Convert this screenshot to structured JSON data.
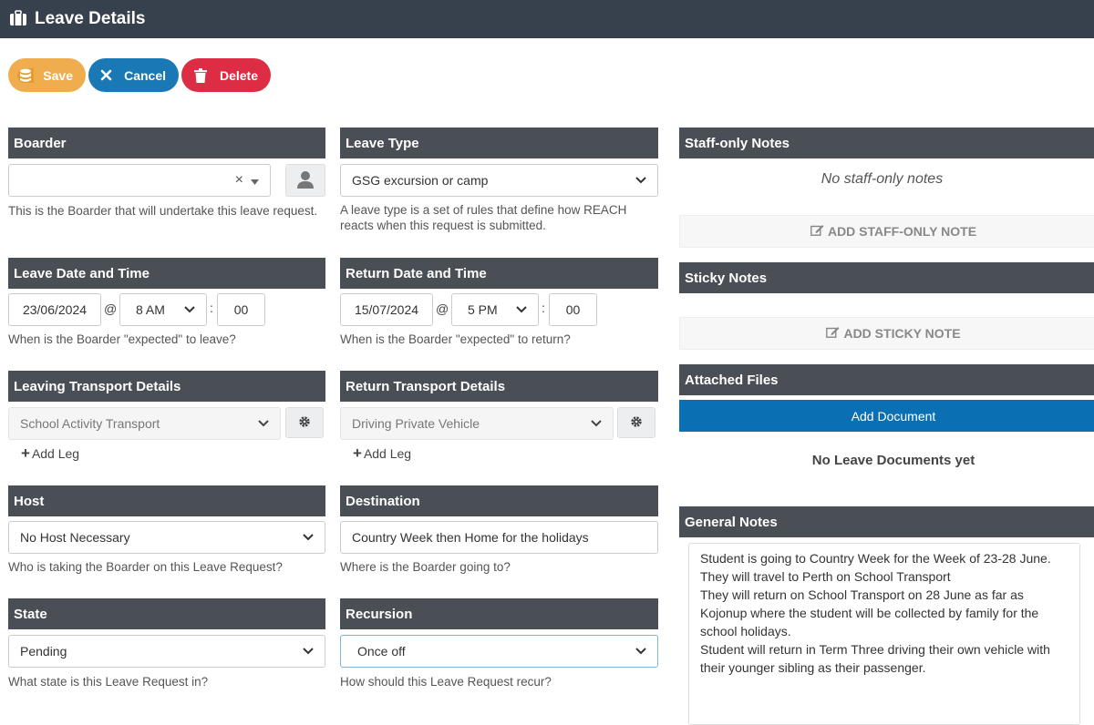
{
  "header": {
    "title": "Leave Details",
    "icon": "suitcase-icon"
  },
  "toolbar": {
    "save_label": "Save",
    "cancel_label": "Cancel",
    "delete_label": "Delete"
  },
  "colors": {
    "header_bg": "#37414e",
    "section_bg": "#4a4f56",
    "save": "#f0ad4e",
    "cancel": "#1a78b4",
    "delete": "#dc2d45",
    "add_doc": "#0a6fb3"
  },
  "boarder": {
    "heading": "Boarder",
    "value": "",
    "clear_symbol": "×",
    "help": "This is the Boarder that will undertake this leave request."
  },
  "leave_type": {
    "heading": "Leave Type",
    "value": "GSG excursion or camp",
    "help": "A leave type is a set of rules that define how REACH reacts when this request is submitted."
  },
  "leave_date": {
    "heading": "Leave Date and Time",
    "date": "23/06/2024",
    "at": "@",
    "hour": "8 AM",
    "sep": ":",
    "minute": "00",
    "help": "When is the Boarder \"expected\" to leave?"
  },
  "return_date": {
    "heading": "Return Date and Time",
    "date": "15/07/2024",
    "at": "@",
    "hour": "5 PM",
    "sep": ":",
    "minute": "00",
    "help": "When is the Boarder \"expected\" to return?"
  },
  "leaving_transport": {
    "heading": "Leaving Transport Details",
    "value": "School Activity Transport",
    "add_leg": "Add Leg"
  },
  "return_transport": {
    "heading": "Return Transport Details",
    "value": "Driving Private Vehicle",
    "add_leg": "Add Leg"
  },
  "host": {
    "heading": "Host",
    "value": "No Host Necessary",
    "help": "Who is taking the Boarder on this Leave Request?"
  },
  "destination": {
    "heading": "Destination",
    "value": "Country Week then Home for the holidays",
    "help": "Where is the Boarder going to?"
  },
  "state": {
    "heading": "State",
    "value": "Pending",
    "help": "What state is this Leave Request in?"
  },
  "recursion": {
    "heading": "Recursion",
    "value": "Once off",
    "help": "How should this Leave Request recur?"
  },
  "staff_notes": {
    "heading": "Staff-only Notes",
    "empty": "No staff-only notes",
    "add_label": "ADD STAFF-ONLY NOTE"
  },
  "sticky_notes": {
    "heading": "Sticky Notes",
    "add_label": "ADD STICKY NOTE"
  },
  "attached_files": {
    "heading": "Attached Files",
    "add_label": "Add Document",
    "empty": "No Leave Documents yet"
  },
  "general_notes": {
    "heading": "General Notes",
    "text": "Student is going to Country Week for the Week of 23-28 June.\nThey will travel to Perth on School Transport\nThey will return on School Transport on 28 June as far as Kojonup where the student will be collected by family for the school holidays.\nStudent will return in Term Three driving their own vehicle with their younger sibling as their passenger."
  }
}
